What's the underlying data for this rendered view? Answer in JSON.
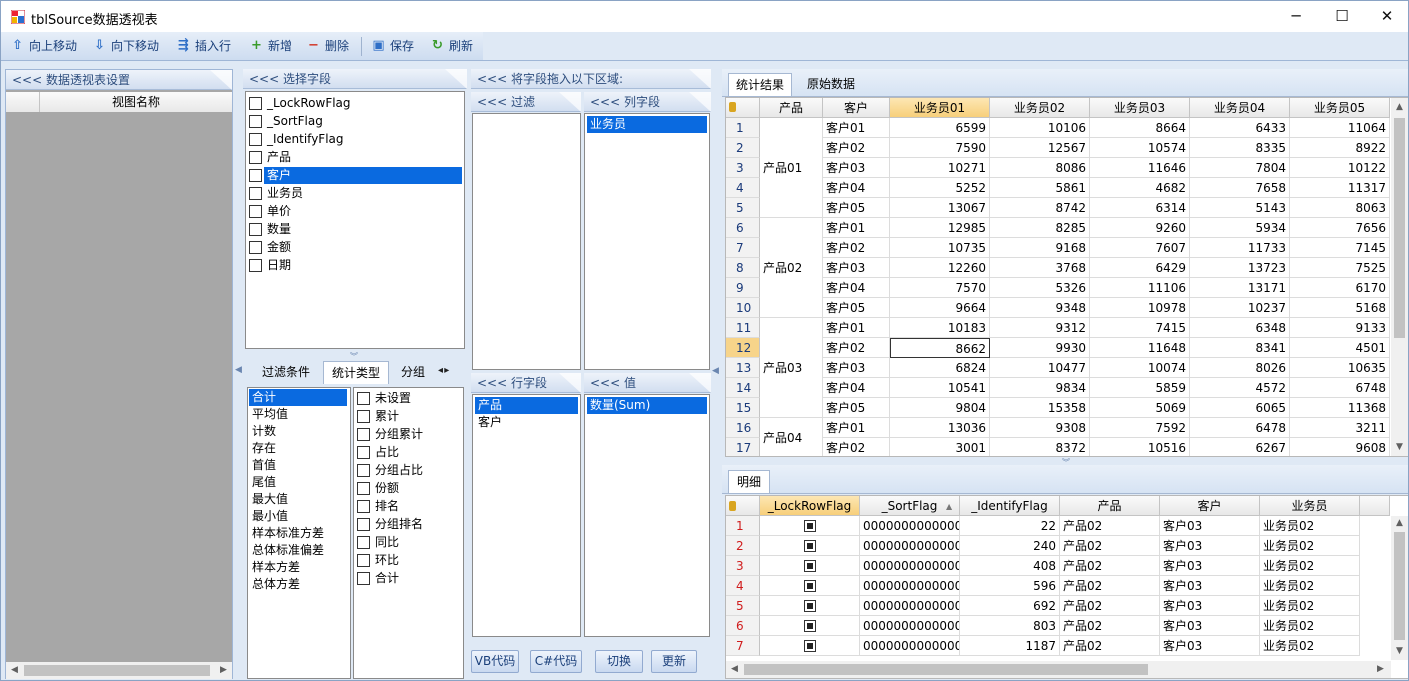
{
  "window": {
    "title": "tblSource数据透视表",
    "min": "─",
    "max": "☐",
    "close": "✕"
  },
  "toolbar": [
    {
      "label": "向上移动",
      "icon": "⇧",
      "name": "move-up-button",
      "color": "#2f6fc7"
    },
    {
      "label": "向下移动",
      "icon": "⇩",
      "name": "move-down-button",
      "color": "#2f6fc7"
    },
    {
      "label": "插入行",
      "icon": "⇶",
      "name": "insert-row-button",
      "color": "#2f6fc7"
    },
    {
      "label": "新增",
      "icon": "+",
      "name": "add-button",
      "color": "#3a9b2a"
    },
    {
      "label": "删除",
      "icon": "−",
      "name": "delete-button",
      "color": "#d23a2a"
    },
    {
      "label": "保存",
      "icon": "▣",
      "name": "save-button",
      "color": "#2f6fc7"
    },
    {
      "label": "刷新",
      "icon": "↻",
      "name": "refresh-button",
      "color": "#3a9b2a"
    }
  ],
  "left_panel": {
    "header": "<<< 数据透视表设置",
    "column": "视图名称"
  },
  "fields_panel": {
    "header": "<<< 选择字段",
    "items": [
      "_LockRowFlag",
      "_SortFlag",
      "_IdentifyFlag",
      "产品",
      "客户",
      "业务员",
      "单价",
      "数量",
      "金额",
      "日期"
    ],
    "selected_index": 4
  },
  "stat_tabs": {
    "tabs": [
      "过滤条件",
      "统计类型",
      "分组"
    ],
    "active": 1
  },
  "stat_types": [
    "合计",
    "平均值",
    "计数",
    "存在",
    "首值",
    "尾值",
    "最大值",
    "最小值",
    "样本标准方差",
    "总体标准偏差",
    "样本方差",
    "总体方差"
  ],
  "stat_options": [
    "未设置",
    "累计",
    "分组累计",
    "占比",
    "分组占比",
    "份额",
    "排名",
    "分组排名",
    "同比",
    "环比",
    "合计"
  ],
  "drop_area": {
    "header": "<<< 将字段拖入以下区域:",
    "filter": {
      "header": "<<< 过滤",
      "items": []
    },
    "columns": {
      "header": "<<< 列字段",
      "items": [
        "业务员"
      ]
    },
    "rows": {
      "header": "<<< 行字段",
      "items": [
        "产品",
        "客户"
      ]
    },
    "values": {
      "header": "<<< 值",
      "items": [
        "数量(Sum)"
      ]
    }
  },
  "bottom_buttons": [
    "VB代码",
    "C#代码",
    "切换",
    "更新"
  ],
  "result_tabs": {
    "tabs": [
      "统计结果",
      "原始数据"
    ],
    "active": 0
  },
  "pivot": {
    "headers": [
      "产品",
      "客户",
      "业务员01",
      "业务员02",
      "业务员03",
      "业务员04",
      "业务员05"
    ],
    "groups": [
      {
        "label": "产品01",
        "start": 0,
        "span": 5
      },
      {
        "label": "产品02",
        "start": 5,
        "span": 5
      },
      {
        "label": "产品03",
        "start": 10,
        "span": 5
      },
      {
        "label": "产品04",
        "start": 15,
        "span": 2
      }
    ],
    "rows": [
      [
        "1",
        "客户01",
        "6599",
        "10106",
        "8664",
        "6433",
        "11064"
      ],
      [
        "2",
        "客户02",
        "7590",
        "12567",
        "10574",
        "8335",
        "8922"
      ],
      [
        "3",
        "客户03",
        "10271",
        "8086",
        "11646",
        "7804",
        "10122"
      ],
      [
        "4",
        "客户04",
        "5252",
        "5861",
        "4682",
        "7658",
        "11317"
      ],
      [
        "5",
        "客户05",
        "13067",
        "8742",
        "6314",
        "5143",
        "8063"
      ],
      [
        "6",
        "客户01",
        "12985",
        "8285",
        "9260",
        "5934",
        "7656"
      ],
      [
        "7",
        "客户02",
        "10735",
        "9168",
        "7607",
        "11733",
        "7145"
      ],
      [
        "8",
        "客户03",
        "12260",
        "3768",
        "6429",
        "13723",
        "7525"
      ],
      [
        "9",
        "客户04",
        "7570",
        "5326",
        "11106",
        "13171",
        "6170"
      ],
      [
        "10",
        "客户05",
        "9664",
        "9348",
        "10978",
        "10237",
        "5168"
      ],
      [
        "11",
        "客户01",
        "10183",
        "9312",
        "7415",
        "6348",
        "9133"
      ],
      [
        "12",
        "客户02",
        "8662",
        "9930",
        "11648",
        "8341",
        "4501"
      ],
      [
        "13",
        "客户03",
        "6824",
        "10477",
        "10074",
        "8026",
        "10635"
      ],
      [
        "14",
        "客户04",
        "10541",
        "9834",
        "5859",
        "4572",
        "6748"
      ],
      [
        "15",
        "客户05",
        "9804",
        "15358",
        "5069",
        "6065",
        "11368"
      ],
      [
        "16",
        "客户01",
        "13036",
        "9308",
        "7592",
        "6478",
        "3211"
      ],
      [
        "17",
        "客户02",
        "3001",
        "8372",
        "10516",
        "6267",
        "9608"
      ]
    ],
    "current_row": 11
  },
  "detail_tab": "明细",
  "detail": {
    "headers": [
      "_LockRowFlag",
      "_SortFlag",
      "_IdentifyFlag",
      "产品",
      "客户",
      "业务员"
    ],
    "rows": [
      [
        "1",
        "0000000000000",
        "22",
        "产品02",
        "客户03",
        "业务员02"
      ],
      [
        "2",
        "0000000000000",
        "240",
        "产品02",
        "客户03",
        "业务员02"
      ],
      [
        "3",
        "0000000000000",
        "408",
        "产品02",
        "客户03",
        "业务员02"
      ],
      [
        "4",
        "0000000000000",
        "596",
        "产品02",
        "客户03",
        "业务员02"
      ],
      [
        "5",
        "0000000000000",
        "692",
        "产品02",
        "客户03",
        "业务员02"
      ],
      [
        "6",
        "0000000000000",
        "803",
        "产品02",
        "客户03",
        "业务员02"
      ],
      [
        "7",
        "0000000000000",
        "1187",
        "产品02",
        "客户03",
        "业务员02"
      ]
    ]
  }
}
